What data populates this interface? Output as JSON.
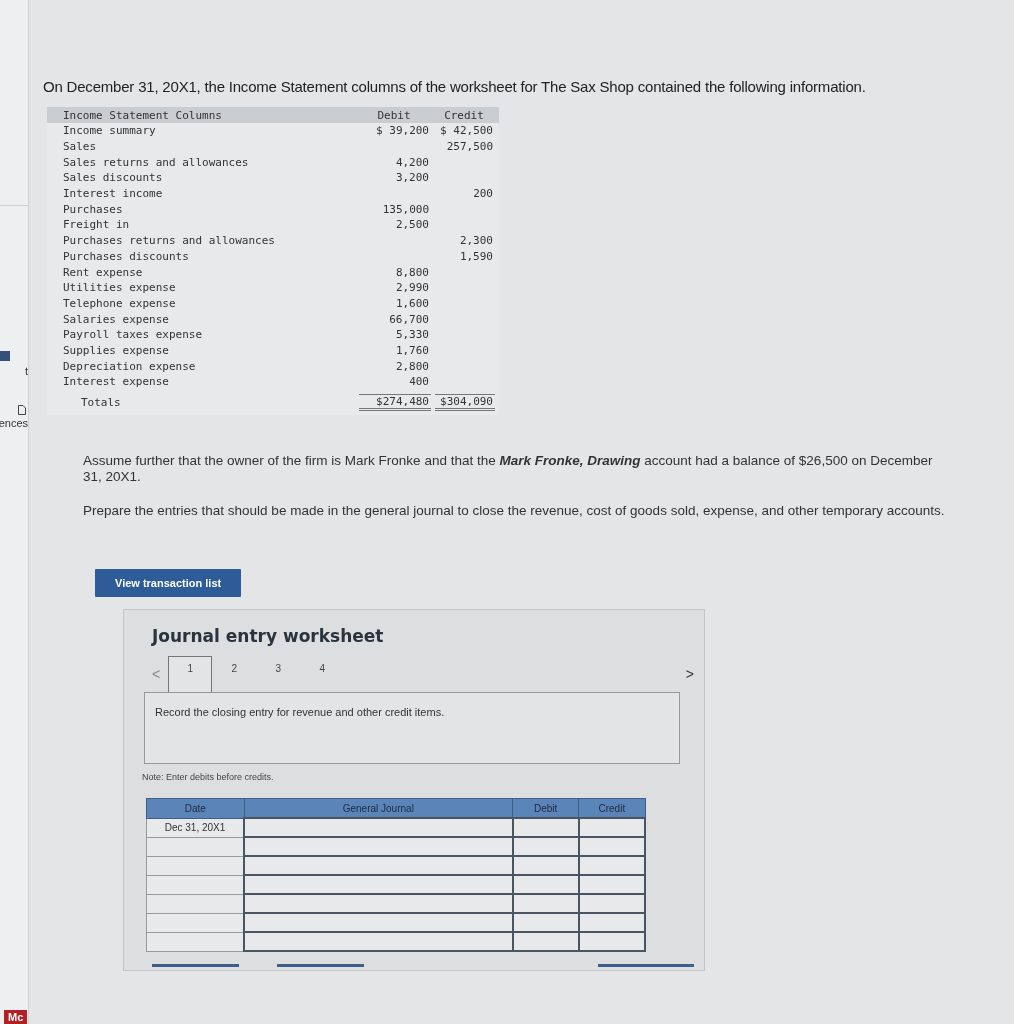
{
  "sidebar": {
    "items": [
      {
        "label": "t"
      },
      {
        "label": "ences"
      }
    ],
    "logo": "Mc"
  },
  "question": {
    "intro": "On December 31, 20X1, the Income Statement columns of the worksheet for The Sax Shop contained the following information.",
    "table": {
      "columns": [
        "Income Statement Columns",
        "Debit",
        "Credit"
      ],
      "rows": [
        {
          "account": "Income summary",
          "debit": "$ 39,200",
          "credit": "$ 42,500"
        },
        {
          "account": "Sales",
          "credit": "257,500"
        },
        {
          "account": "Sales returns and allowances",
          "debit": "4,200"
        },
        {
          "account": "Sales discounts",
          "debit": "3,200"
        },
        {
          "account": "Interest income",
          "credit": "200"
        },
        {
          "account": "Purchases",
          "debit": "135,000"
        },
        {
          "account": "Freight in",
          "debit": "2,500"
        },
        {
          "account": "Purchases returns and allowances",
          "credit": "2,300"
        },
        {
          "account": "Purchases discounts",
          "credit": "1,590"
        },
        {
          "account": "Rent expense",
          "debit": "8,800"
        },
        {
          "account": "Utilities expense",
          "debit": "2,990"
        },
        {
          "account": "Telephone expense",
          "debit": "1,600"
        },
        {
          "account": "Salaries expense",
          "debit": "66,700"
        },
        {
          "account": "Payroll taxes expense",
          "debit": "5,330"
        },
        {
          "account": "Supplies expense",
          "debit": "1,760"
        },
        {
          "account": "Depreciation expense",
          "debit": "2,800"
        },
        {
          "account": "Interest expense",
          "debit": "400"
        }
      ],
      "totals": {
        "account": "Totals",
        "debit": "$274,480",
        "credit": "$304,090"
      }
    },
    "paragraphs": [
      "Assume further that the owner of the firm is Mark Fronke and that the **Mark Fronke, Drawing** account had a balance of $26,500 on December 31, 20X1.",
      "Prepare the entries that should be made in the general journal to close the revenue, cost of goods sold, expense, and other temporary accounts."
    ]
  },
  "button": "View transaction list",
  "worksheet": {
    "title": "Journal entry worksheet",
    "prev": "<",
    "next": ">",
    "tabs": [
      {
        "label": "1",
        "selected": true
      },
      {
        "label": "2",
        "selected": false
      },
      {
        "label": "3",
        "selected": false
      },
      {
        "label": "4",
        "selected": false
      }
    ],
    "instruction": "Record the closing entry for revenue and other credit items.",
    "note": "Note: Enter debits before credits.",
    "journal": {
      "columns": [
        "Date",
        "General Journal",
        "Debit",
        "Credit"
      ],
      "rows": [
        {
          "date": "Dec 31, 20X1"
        },
        {},
        {},
        {},
        {},
        {},
        {}
      ]
    }
  }
}
